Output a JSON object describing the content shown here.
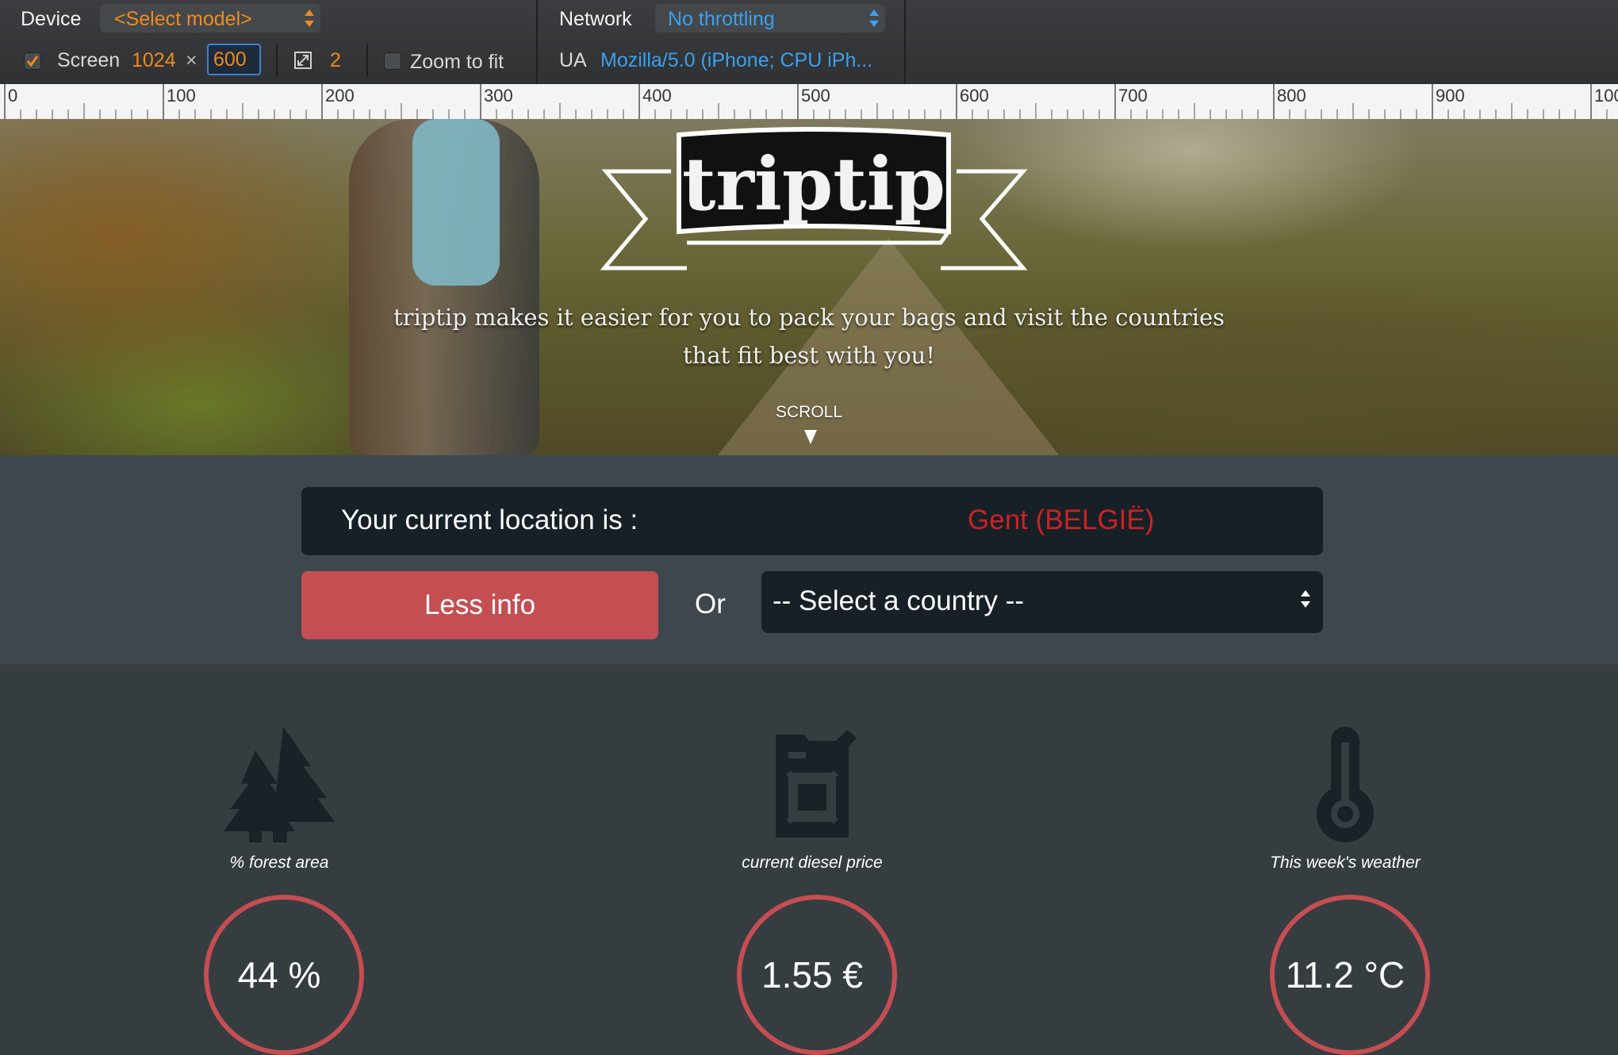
{
  "devtools": {
    "device_label": "Device",
    "device_select": "<Select model>",
    "network_label": "Network",
    "network_select": "No throttling",
    "screen_label": "Screen",
    "screen_width": "1024",
    "times": "×",
    "screen_height": "600",
    "pixel_ratio": "2",
    "zoom_to_fit_label": "Zoom to fit",
    "ua_label": "UA",
    "ua_value": "Mozilla/5.0 (iPhone; CPU iPh...",
    "colors": {
      "orange": "#f08a1e",
      "blue": "#3ba0f0"
    }
  },
  "ruler": {
    "labels": [
      "0",
      "100",
      "200",
      "300",
      "400",
      "500",
      "600",
      "700",
      "800",
      "900",
      "100"
    ]
  },
  "hero": {
    "logo_text": "triptip",
    "tagline_line1": "triptip makes it easier for you to pack your bags and visit the countries",
    "tagline_line2": "that fit best with you!",
    "scroll_label": "SCROLL"
  },
  "location": {
    "label": "Your current location is :",
    "value": "Gent (BELGIË)",
    "less_info_button": "Less info",
    "or_label": "Or",
    "country_select": "-- Select a country --",
    "colors": {
      "accent": "#c54e52",
      "location_value": "#cc2222"
    }
  },
  "stats": [
    {
      "icon": "forest-icon",
      "label": "% forest area",
      "value": "44 %"
    },
    {
      "icon": "jerrycan-icon",
      "label": "current diesel price",
      "value": "1.55 €"
    },
    {
      "icon": "thermometer-icon",
      "label": "This week's weather",
      "value": "11.2 °C"
    }
  ]
}
